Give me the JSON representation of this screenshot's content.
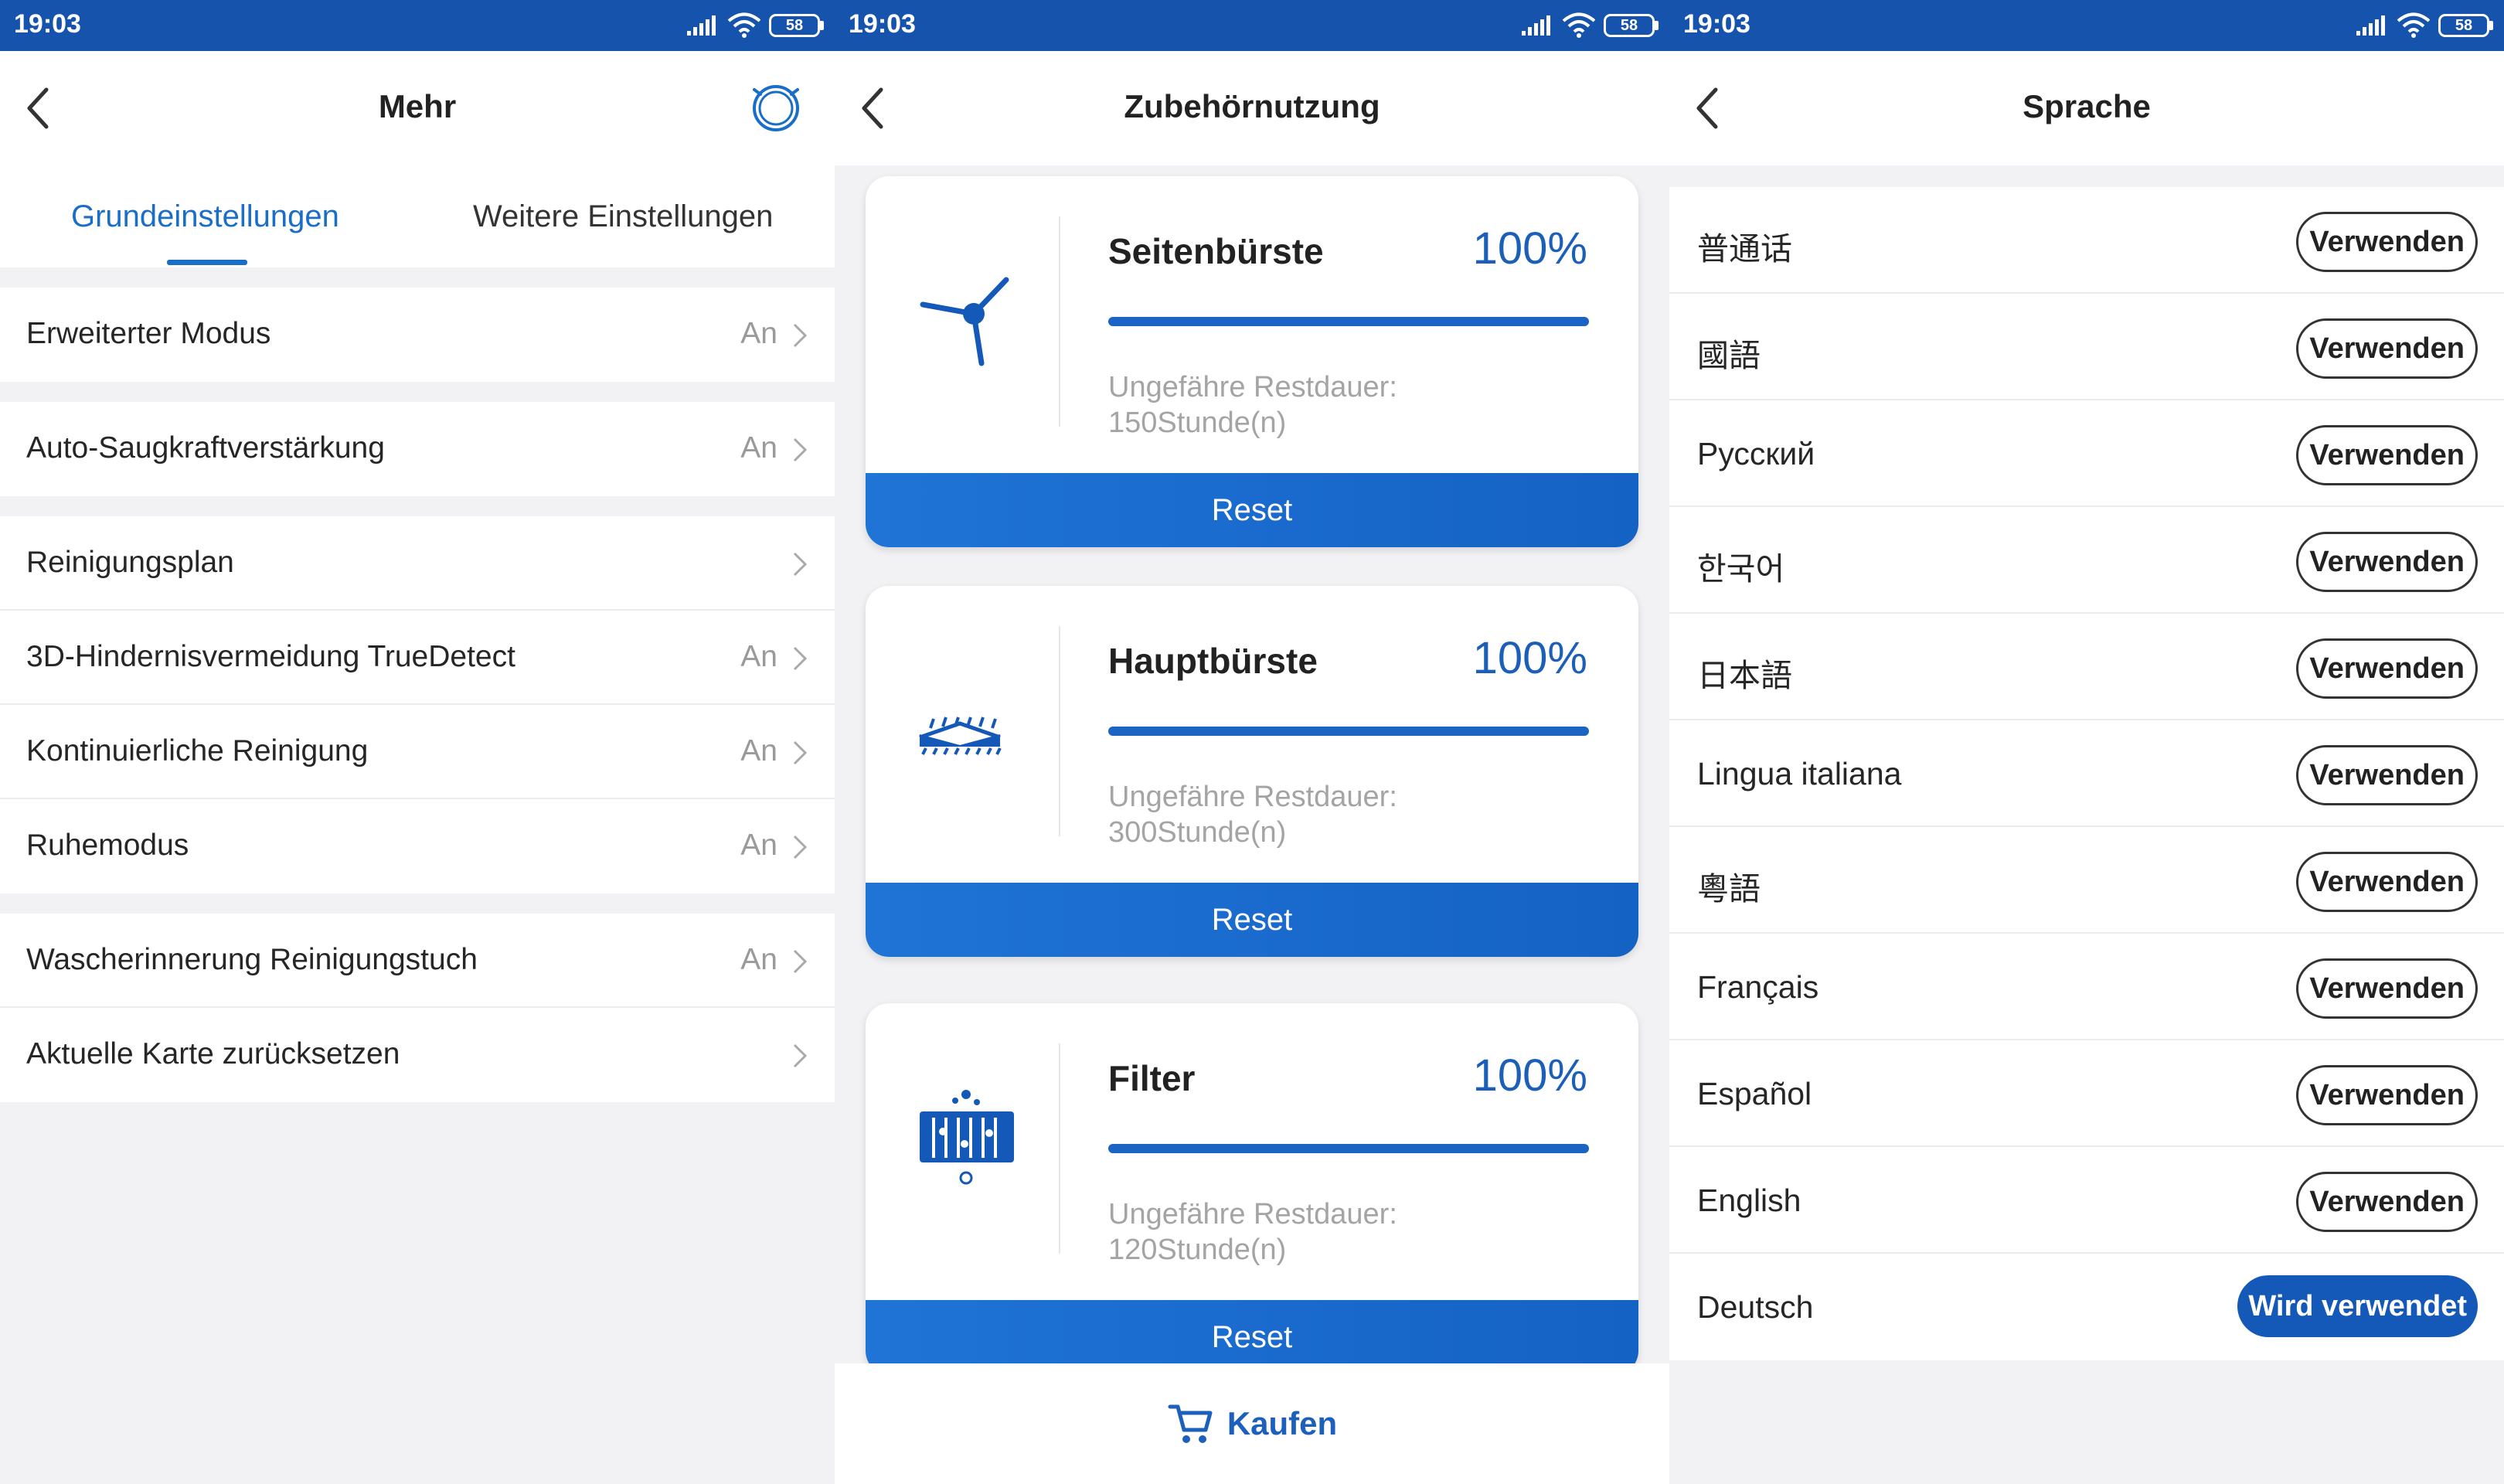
{
  "status_bar": {
    "time": "19:03",
    "battery": "58"
  },
  "panel1": {
    "title": "Mehr",
    "tabs": [
      {
        "label": "Grundeinstellungen",
        "active": true
      },
      {
        "label": "Weitere Einstellungen",
        "active": false
      }
    ],
    "rows": [
      {
        "label": "Erweiterter Modus",
        "value": "An"
      },
      {
        "label": "Auto-Saugkraftverstärkung",
        "value": "An"
      },
      {
        "label": "Reinigungsplan",
        "value": ""
      },
      {
        "label": "3D-Hindernisvermeidung TrueDetect",
        "value": "An"
      },
      {
        "label": "Kontinuierliche Reinigung",
        "value": "An"
      },
      {
        "label": "Ruhemodus",
        "value": "An"
      },
      {
        "label": "Wascherinnerung Reinigungstuch",
        "value": "An"
      },
      {
        "label": "Aktuelle Karte zurücksetzen",
        "value": ""
      }
    ]
  },
  "panel2": {
    "title": "Zubehörnutzung",
    "cards": [
      {
        "name": "Seitenbürste",
        "percent": "100%",
        "level": 1.0,
        "remaining_label": "Ungefähre Restdauer:",
        "remaining_value": "150Stunde(n)",
        "reset_label": "Reset",
        "icon": "side-brush-icon"
      },
      {
        "name": "Hauptbürste",
        "percent": "100%",
        "level": 1.0,
        "remaining_label": "Ungefähre Restdauer:",
        "remaining_value": "300Stunde(n)",
        "reset_label": "Reset",
        "icon": "main-brush-icon"
      },
      {
        "name": "Filter",
        "percent": "100%",
        "level": 1.0,
        "remaining_label": "Ungefähre Restdauer:",
        "remaining_value": "120Stunde(n)",
        "reset_label": "Reset",
        "icon": "filter-icon"
      }
    ],
    "buy_label": "Kaufen"
  },
  "panel3": {
    "title": "Sprache",
    "languages": [
      {
        "name": "普通话",
        "button": "Verwenden",
        "active": false
      },
      {
        "name": "國語",
        "button": "Verwenden",
        "active": false
      },
      {
        "name": "Русский",
        "button": "Verwenden",
        "active": false
      },
      {
        "name": "한국어",
        "button": "Verwenden",
        "active": false
      },
      {
        "name": "日本語",
        "button": "Verwenden",
        "active": false
      },
      {
        "name": "Lingua italiana",
        "button": "Verwenden",
        "active": false
      },
      {
        "name": "粵語",
        "button": "Verwenden",
        "active": false
      },
      {
        "name": "Français",
        "button": "Verwenden",
        "active": false
      },
      {
        "name": "Español",
        "button": "Verwenden",
        "active": false
      },
      {
        "name": "English",
        "button": "Verwenden",
        "active": false
      },
      {
        "name": "Deutsch",
        "button": "Wird verwendet",
        "active": true
      }
    ]
  },
  "colors": {
    "status_bar": "#1553ad",
    "accent": "#1a6ec8",
    "button_active": "#1458b8"
  }
}
